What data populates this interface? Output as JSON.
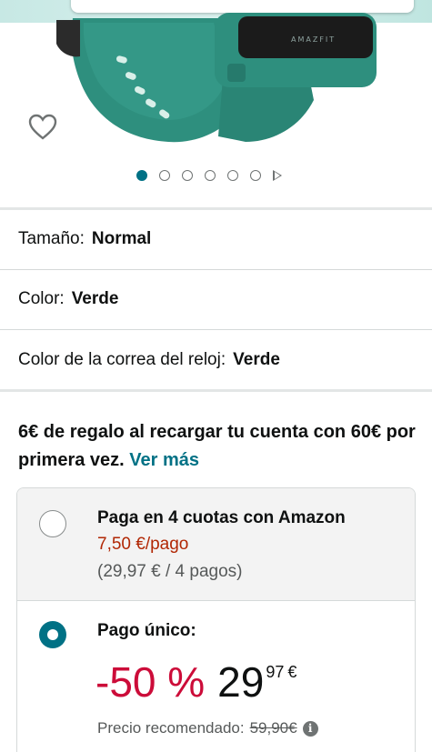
{
  "gallery": {
    "brand_on_device": "AMAZFIT",
    "dots_total": 6,
    "active_index": 0,
    "wishlist_icon": "heart-outline-icon",
    "video_icon": "play-icon"
  },
  "variations": [
    {
      "key": "Tamaño:",
      "value": "Normal"
    },
    {
      "key": "Color:",
      "value": "Verde"
    },
    {
      "key": "Color de la correa del reloj:",
      "value": "Verde"
    }
  ],
  "promo": {
    "text": "6€ de regalo al recargar tu cuenta con 60€ por primera vez.",
    "link": "Ver más"
  },
  "payment": {
    "installments": {
      "title": "Paga en 4 cuotas con Amazon",
      "per_payment": "7,50 €/pago",
      "total": "(29,97 € / 4 pagos)",
      "selected": false
    },
    "single": {
      "title": "Pago único:",
      "discount": "-50 %",
      "price_whole": "29",
      "price_fraction": "97",
      "currency": "€",
      "rrp_label": "Precio recomendado:",
      "rrp_value": "59,90€",
      "selected": true
    }
  },
  "colors": {
    "accent": "#007185",
    "deal_red": "#cc0c39",
    "price_red": "#b12704",
    "band_green": "#2e8f7e"
  }
}
